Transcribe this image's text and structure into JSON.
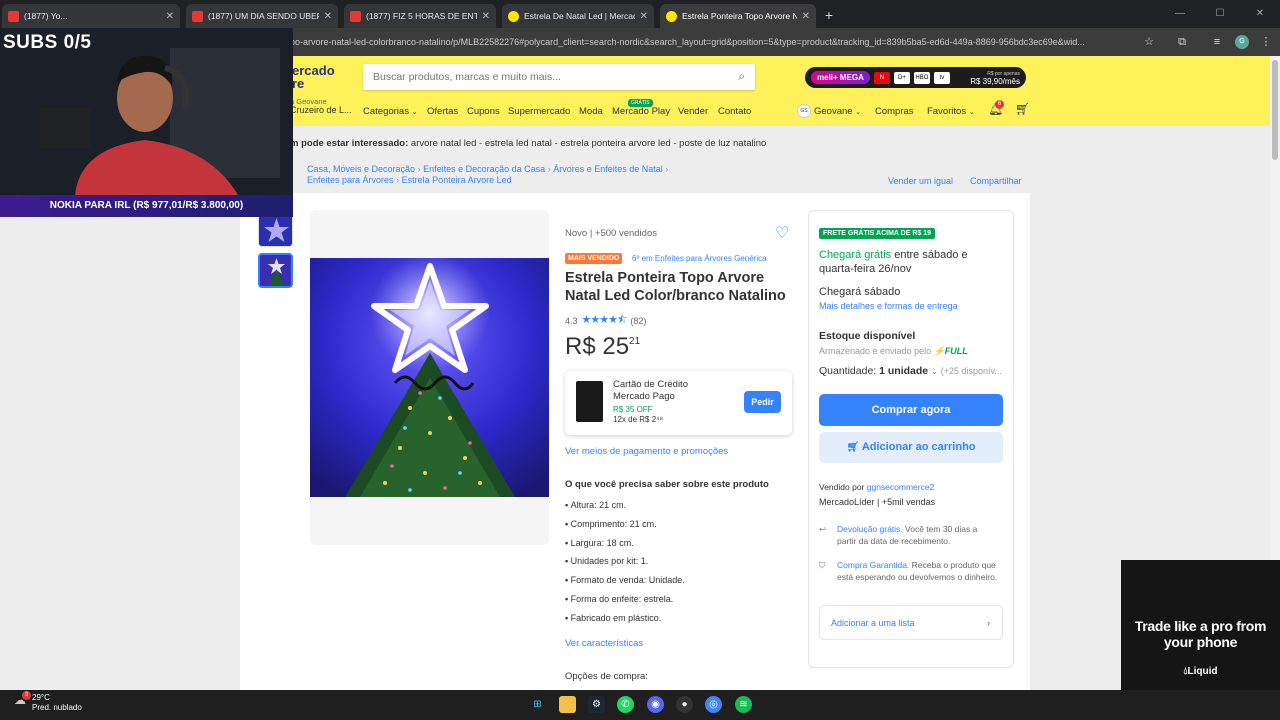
{
  "browser": {
    "tabs": [
      {
        "title": "(1877) Yo...",
        "favicon": "youtube"
      },
      {
        "title": "(1877) UM DIA SENDO UBER - ...",
        "favicon": "youtube"
      },
      {
        "title": "(1877) FIZ 5 HORAS DE ENTRE...",
        "favicon": "youtube"
      },
      {
        "title": "Estrela De Natal Led | Mercad...",
        "favicon": "mercadolivre"
      },
      {
        "title": "Estrela Ponteira Topo Arvore N...",
        "favicon": "mercadolivre"
      }
    ],
    "url": "po-arvore-natal-led-colorbranco-natalino/p/MLB22582276#polycard_client=search-nordic&search_layout=grid&position=5&type=product&tracking_id=839b5ba5-ed6d-449a-8869-956bdc3ec69e&wid..."
  },
  "header": {
    "logo_line1": "ercado",
    "logo_line2": "re",
    "search_placeholder": "Buscar produtos, marcas e muito mais...",
    "promo": {
      "brand": "meli+",
      "tier": "MEGA",
      "price_small": "R$ por apenas",
      "price": "R$ 39,90/mês",
      "logos": [
        "N",
        "D+",
        "HBO",
        "tv"
      ]
    },
    "address_small": "a Geovane",
    "address": "Cruzeiro de L...",
    "nav": [
      "Categorias",
      "Ofertas",
      "Cupons",
      "Supermercado",
      "Moda",
      "Mercado Play",
      "Vender",
      "Contato"
    ],
    "free_tag": "GRÁTIS",
    "user_initials": "GS",
    "user": "Geovane",
    "user_links": [
      "Compras",
      "Favoritos"
    ],
    "notif_count": "6"
  },
  "related": {
    "label": "m pode estar interessado:",
    "items": "arvore natal led - estrela led natal - estrela ponteira arvore led - poste de luz natalino"
  },
  "breadcrumb": {
    "line1": [
      "Casa, Móveis e Decoração",
      "Enfeites e Decoração da Casa",
      "Árvores e Enfeites de Natal"
    ],
    "line2": [
      "Enfeites para Árvores",
      "Estrela Ponteira Arvore Led"
    ],
    "sell_same": "Vender um igual",
    "share": "Compartilhar"
  },
  "product": {
    "condition": "Novo  |  +500 vendidos",
    "badge": "MAIS VENDIDO",
    "rank": "6º em Enfeites para Árvores Genérica",
    "title": "Estrela Ponteira Topo Arvore Natal Led Color/branco Natalino",
    "rating": "4.3",
    "rating_value": 4.3,
    "reviews": "(82)",
    "price_int": "R$ 25",
    "price_cents": "21",
    "credit": {
      "title": "Cartão de Crédito Mercado Pago",
      "off": "R$ 35 OFF",
      "installments": "12x de R$ 2⁴⁸",
      "button": "Pedir"
    },
    "pay_link": "Ver meios de pagamento e promoções",
    "specs_title": "O que você precisa saber sobre este produto",
    "specs": [
      "Altura: 21 cm.",
      "Comprimento: 21 cm.",
      "Largura: 18 cm.",
      "Unidades por kit: 1.",
      "Formato de venda: Unidade.",
      "Forma do enfeite: estrela.",
      "Fabricado em plástico."
    ],
    "specs_link": "Ver características",
    "options": "Opções de compra:"
  },
  "buybox": {
    "frete": "FRETE GRÁTIS ACIMA DE R$ 19",
    "arrive_green": "Chegará grátis",
    "arrive_rest": " entre sábado e quarta-feira 26/nov",
    "arrive2": "Chegará sábado",
    "details": "Mais detalhes e formas de entrega",
    "stock": "Estoque disponível",
    "stored": "Armazenado e enviado pelo",
    "full": "⚡FULL",
    "qty_label": "Quantidade:",
    "qty": "1 unidade",
    "qty_more": "(+25 disponív...",
    "buy": "Comprar agora",
    "add_cart": "Adicionar ao carrinho",
    "seller_label": "Vendido por",
    "seller": "ggnsecommerce2",
    "leader": "MercadoLíder  |  +5mil vendas",
    "return_link": "Devolução grátis.",
    "return_text": " Você tem 30 dias a partir da data de recebimento.",
    "guarantee_link": "Compra Garantida.",
    "guarantee_text": " Receba o produto que está esperando ou devolvemos o dinheiro.",
    "list": "Adicionar a uma lista"
  },
  "overlay": {
    "subs": "SUBS 0/5",
    "nokia": "NOKIA PARA IRL (R$ 977,01/R$ 3.800,00)",
    "ad_text": "Trade like a pro from your phone",
    "ad_brand": "Liquid"
  },
  "taskbar": {
    "temp": "29°C",
    "weather": "Pred. nublado",
    "weather_badge": "3"
  }
}
